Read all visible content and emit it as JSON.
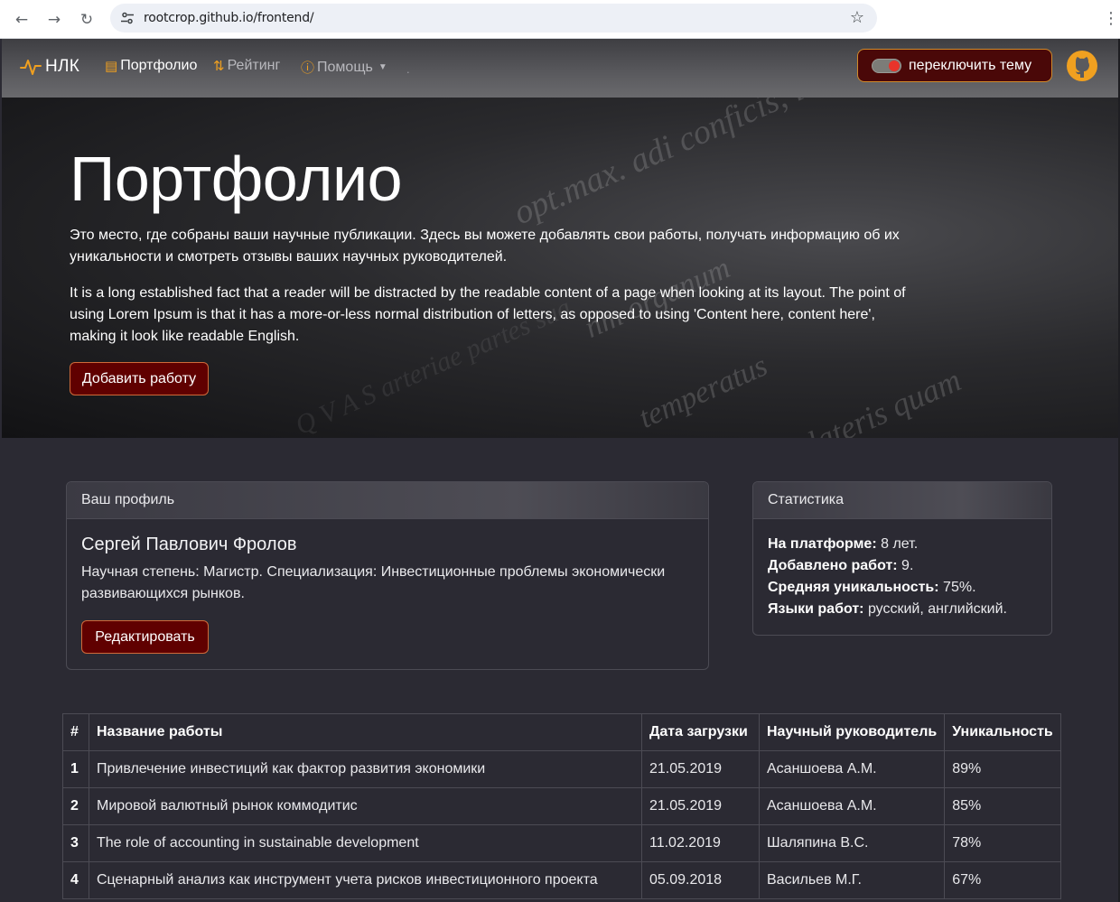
{
  "browser": {
    "url": "rootcrop.github.io/frontend/"
  },
  "navbar": {
    "brand": "НЛК",
    "links": [
      {
        "label": "Портфолио",
        "icon": "document-list-icon"
      },
      {
        "label": "Рейтинг",
        "icon": "sort-icon"
      },
      {
        "label": "Помощь",
        "icon": "question-circle-icon"
      }
    ],
    "dot": ".",
    "theme_toggle_label": "переключить тему",
    "accent_color": "#f0a020"
  },
  "hero": {
    "title": "Портфолио",
    "lead_ru": "Это место, где собраны ваши научные публикации. Здесь вы можете добавлять свои работы, получать информацию об их уникальности и смотреть отзывы ваших научных руководителей.",
    "lead_en": "It is a long established fact that a reader will be distracted by the readable content of a page when looking at its layout. The point of using Lorem Ipsum is that it has a more-or-less normal distribution of letters, as opposed to using 'Content here, content here', making it look like readable English.",
    "add_button": "Добавить работу"
  },
  "profile": {
    "header": "Ваш профиль",
    "name": "Сергей Павлович Фролов",
    "description": "Научная степень: Магистр. Специализация: Инвестиционные проблемы экономически развивающихся рынков.",
    "edit_button": "Редактировать"
  },
  "stats": {
    "header": "Статистика",
    "items": [
      {
        "label": "На платформе:",
        "value": " 8 лет."
      },
      {
        "label": "Добавлено работ:",
        "value": " 9."
      },
      {
        "label": "Средняя уникальность:",
        "value": " 75%."
      },
      {
        "label": "Языки работ:",
        "value": " русский, английский."
      }
    ]
  },
  "table": {
    "headers": [
      "#",
      "Название работы",
      "Дата загрузки",
      "Научный руководитель",
      "Уникальность"
    ],
    "rows": [
      [
        "1",
        "Привлечение инвестиций как фактор развития экономики",
        "21.05.2019",
        "Асаншоева А.М.",
        "89%"
      ],
      [
        "2",
        "Мировой валютный рынок коммодитис",
        "21.05.2019",
        "Асаншоева А.М.",
        "85%"
      ],
      [
        "3",
        "The role of accounting in sustainable development",
        "11.02.2019",
        "Шаляпина В.С.",
        "78%"
      ],
      [
        "4",
        "Сценарный анализ как инструмент учета рисков инвестиционного проекта",
        "05.09.2018",
        "Васильев М.Г.",
        "67%"
      ]
    ]
  }
}
